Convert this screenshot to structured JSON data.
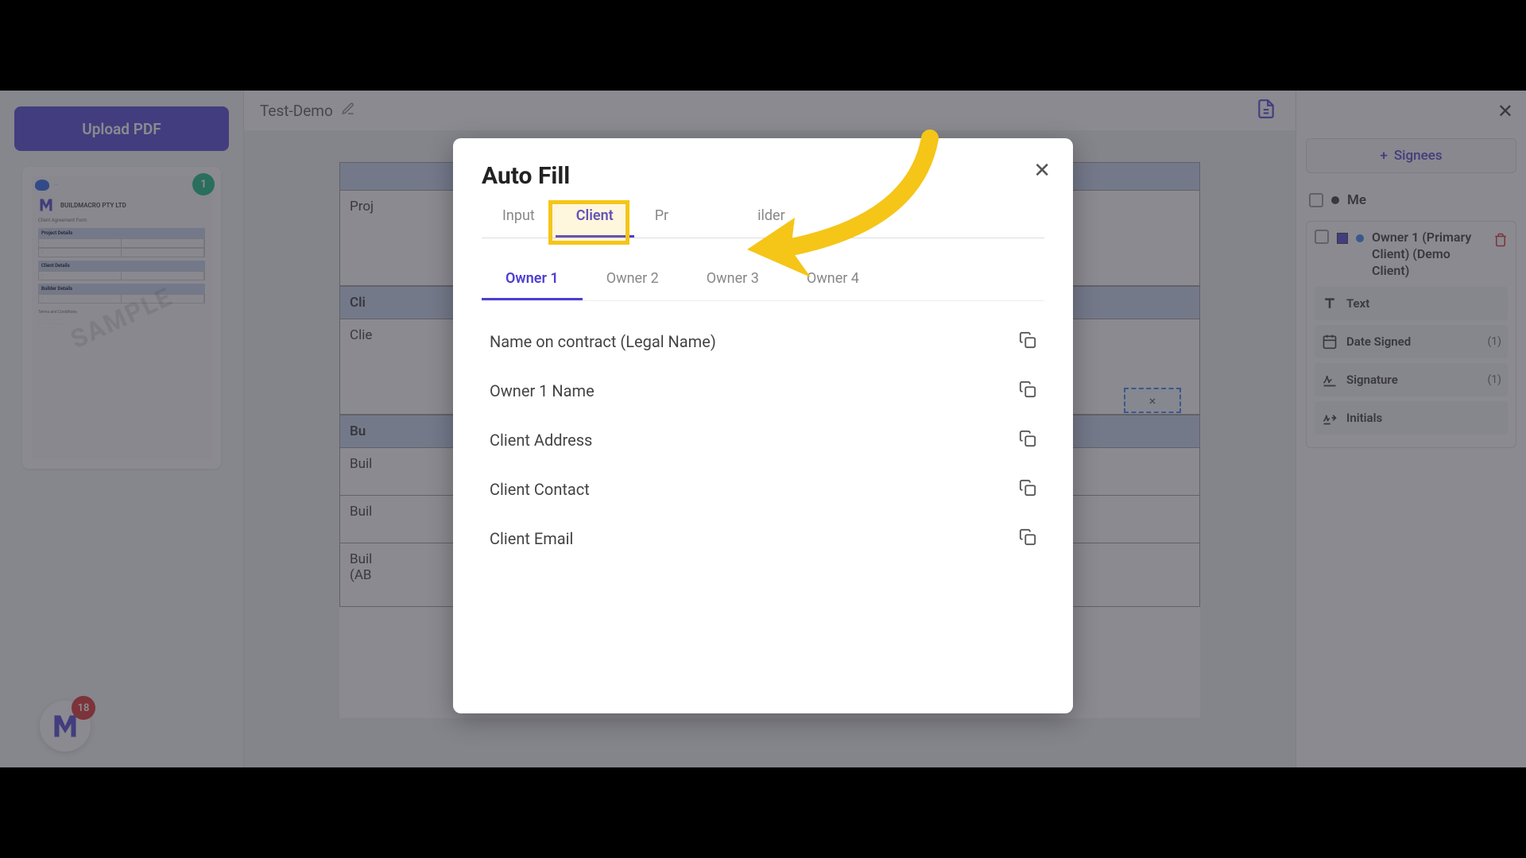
{
  "upload_button": "Upload PDF",
  "thumbnail": {
    "badge": "1",
    "company": "BUILDMACRO PTY LTD",
    "subtitle": "Client Agreement Form",
    "watermark": "SAMPLE",
    "sections": [
      "Project Details",
      "Client Details",
      "Builder Details"
    ],
    "footer": "Terms and Conditions"
  },
  "fab_badge": "18",
  "document": {
    "title": "Test-Demo",
    "sections": [
      {
        "header": "",
        "label": "Proj"
      },
      {
        "header": "Cli",
        "label": "Clie"
      },
      {
        "header": "Bu",
        "labels": [
          "Buil",
          "Buil",
          "Buil\n(AB"
        ]
      }
    ],
    "field_x": "×"
  },
  "right_panel": {
    "add_signees": "Signees",
    "me_label": "Me",
    "signee": {
      "title": "Owner 1 (Primary Client) (Demo Client)"
    },
    "fields": [
      {
        "icon": "text",
        "label": "Text",
        "count": ""
      },
      {
        "icon": "date",
        "label": "Date Signed",
        "count": "(1)"
      },
      {
        "icon": "signature",
        "label": "Signature",
        "count": "(1)"
      },
      {
        "icon": "initials",
        "label": "Initials",
        "count": ""
      }
    ]
  },
  "modal": {
    "title": "Auto Fill",
    "tabs": [
      "Input",
      "Client",
      "Pr",
      "ilder"
    ],
    "active_tab": "Client",
    "sub_tabs": [
      "Owner 1",
      "Owner 2",
      "Owner 3",
      "Owner 4"
    ],
    "active_sub_tab": "Owner 1",
    "fields": [
      "Name on contract (Legal Name)",
      "Owner 1 Name",
      "Client Address",
      "Client Contact",
      "Client Email"
    ]
  }
}
